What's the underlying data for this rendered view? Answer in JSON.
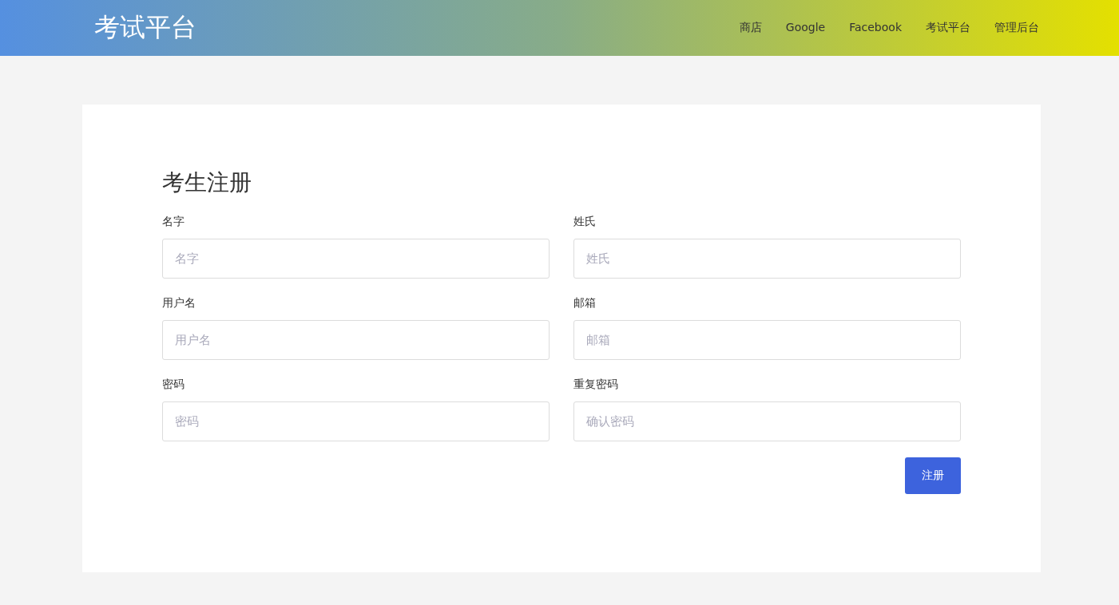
{
  "header": {
    "brand": "考试平台",
    "nav": [
      "商店",
      "Google",
      "Facebook",
      "考试平台",
      "管理后台"
    ]
  },
  "form": {
    "title": "考生注册",
    "fields": [
      {
        "label": "名字",
        "placeholder": "名字"
      },
      {
        "label": "姓氏",
        "placeholder": "姓氏"
      },
      {
        "label": "用户名",
        "placeholder": "用户名"
      },
      {
        "label": "邮箱",
        "placeholder": "邮箱"
      },
      {
        "label": "密码",
        "placeholder": "密码"
      },
      {
        "label": "重复密码",
        "placeholder": "确认密码"
      }
    ],
    "submit": "注册"
  }
}
